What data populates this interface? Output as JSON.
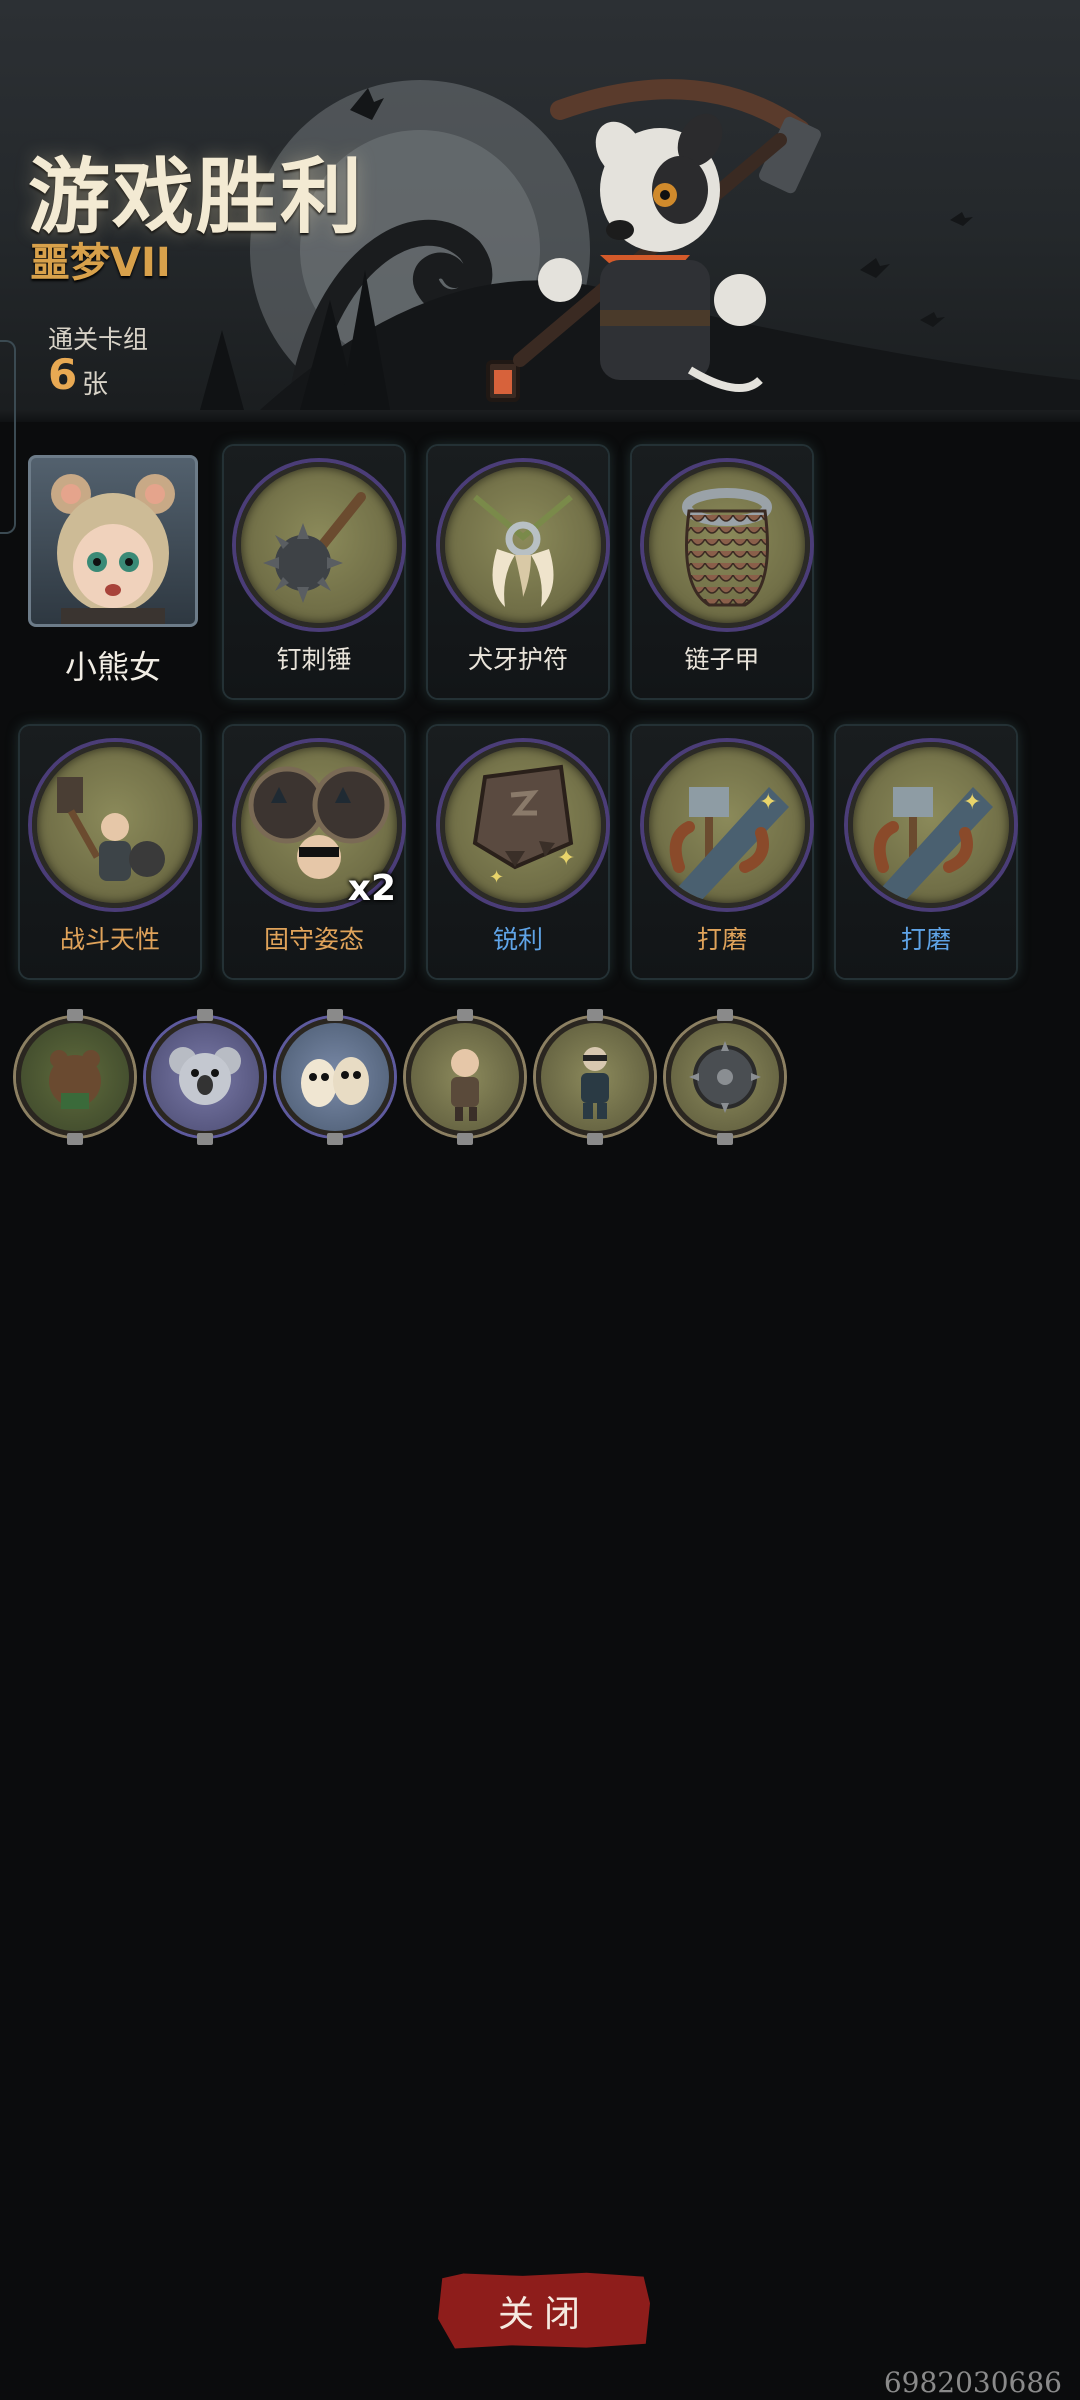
{
  "header": {
    "title": "游戏胜利",
    "difficulty": "噩梦VII",
    "deck_label": "通关卡组",
    "deck_count": "6",
    "deck_unit": "张"
  },
  "hero": {
    "name": "小熊女",
    "icon": "bear-girl-portrait"
  },
  "cards_row1": [
    {
      "label": "钉刺锤",
      "icon": "spiked-mace-icon",
      "color": "white"
    },
    {
      "label": "犬牙护符",
      "icon": "fang-amulet-icon",
      "color": "white"
    },
    {
      "label": "链子甲",
      "icon": "chainmail-icon",
      "color": "white"
    }
  ],
  "cards_row2": [
    {
      "label": "战斗天性",
      "icon": "battle-instinct-icon",
      "color": "orange"
    },
    {
      "label": "固守姿态",
      "icon": "defensive-stance-icon",
      "color": "orange",
      "badge": "x2"
    },
    {
      "label": "锐利",
      "icon": "sharp-icon",
      "color": "blue"
    },
    {
      "label": "打磨",
      "icon": "grind-icon",
      "color": "orange"
    },
    {
      "label": "打磨",
      "icon": "grind-icon",
      "color": "blue"
    }
  ],
  "relics": [
    {
      "icon": "forest-bear-relic-icon"
    },
    {
      "icon": "koala-relic-icon"
    },
    {
      "icon": "owls-relic-icon"
    },
    {
      "icon": "warrior-girl-relic-icon"
    },
    {
      "icon": "ninja-relic-icon"
    },
    {
      "icon": "spiked-shield-relic-icon"
    }
  ],
  "close_button": "关闭",
  "watermark": "6982030686",
  "colors": {
    "accent_orange": "#e0a35a",
    "accent_blue": "#5fa3e6",
    "button_red": "#8e1d1b"
  }
}
